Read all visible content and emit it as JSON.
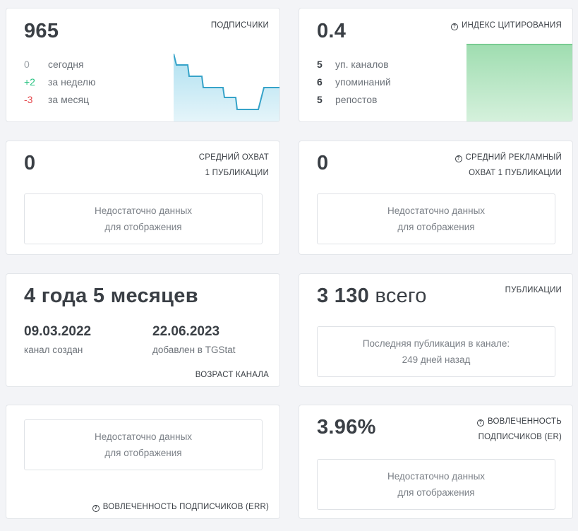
{
  "subscribers": {
    "value": "965",
    "caption": "ПОДПИСЧИКИ",
    "rows": [
      {
        "num": "0",
        "label": "сегодня",
        "color": "#9aa0a6"
      },
      {
        "num": "+2",
        "label": "за неделю",
        "color": "#27c281"
      },
      {
        "num": "-3",
        "label": "за месяц",
        "color": "#e5484d"
      }
    ],
    "sparkline_color": "#36a3c9"
  },
  "citation": {
    "value": "0.4",
    "caption": "ИНДЕКС ЦИТИРОВАНИЯ",
    "rows": [
      {
        "num": "5",
        "label": "уп. каналов"
      },
      {
        "num": "6",
        "label": "упоминаний"
      },
      {
        "num": "5",
        "label": "репостов"
      }
    ],
    "chart_color": "#5cc07a"
  },
  "avg_reach": {
    "value": "0",
    "caption_line1": "СРЕДНИЙ ОХВАТ",
    "caption_line2": "1 ПУБЛИКАЦИИ",
    "nodata_line1": "Недостаточно данных",
    "nodata_line2": "для отображения"
  },
  "avg_ad_reach": {
    "value": "0",
    "caption_line1": "СРЕДНИЙ РЕКЛАМНЫЙ",
    "caption_line2": "ОХВАТ 1 ПУБЛИКАЦИИ",
    "nodata_line1": "Недостаточно данных",
    "nodata_line2": "для отображения"
  },
  "channel_age": {
    "value": "4 года 5 месяцев",
    "created_date": "09.03.2022",
    "created_label": "канал создан",
    "added_date": "22.06.2023",
    "added_label": "добавлен в TGStat",
    "caption": "ВОЗРАСТ КАНАЛА"
  },
  "publications": {
    "value": "3 130",
    "value_suffix": "всего",
    "caption": "ПУБЛИКАЦИИ",
    "last_line1": "Последняя публикация в канале:",
    "last_line2": "249 дней назад"
  },
  "err": {
    "nodata_line1": "Недостаточно данных",
    "nodata_line2": "для отображения",
    "caption": "ВОВЛЕЧЕННОСТЬ ПОДПИСЧИКОВ (ERR)"
  },
  "er": {
    "value": "3.96%",
    "caption_line1": "ВОВЛЕЧЕННОСТЬ",
    "caption_line2": "ПОДПИСЧИКОВ (ER)",
    "nodata_line1": "Недостаточно данных",
    "nodata_line2": "для отображения"
  }
}
